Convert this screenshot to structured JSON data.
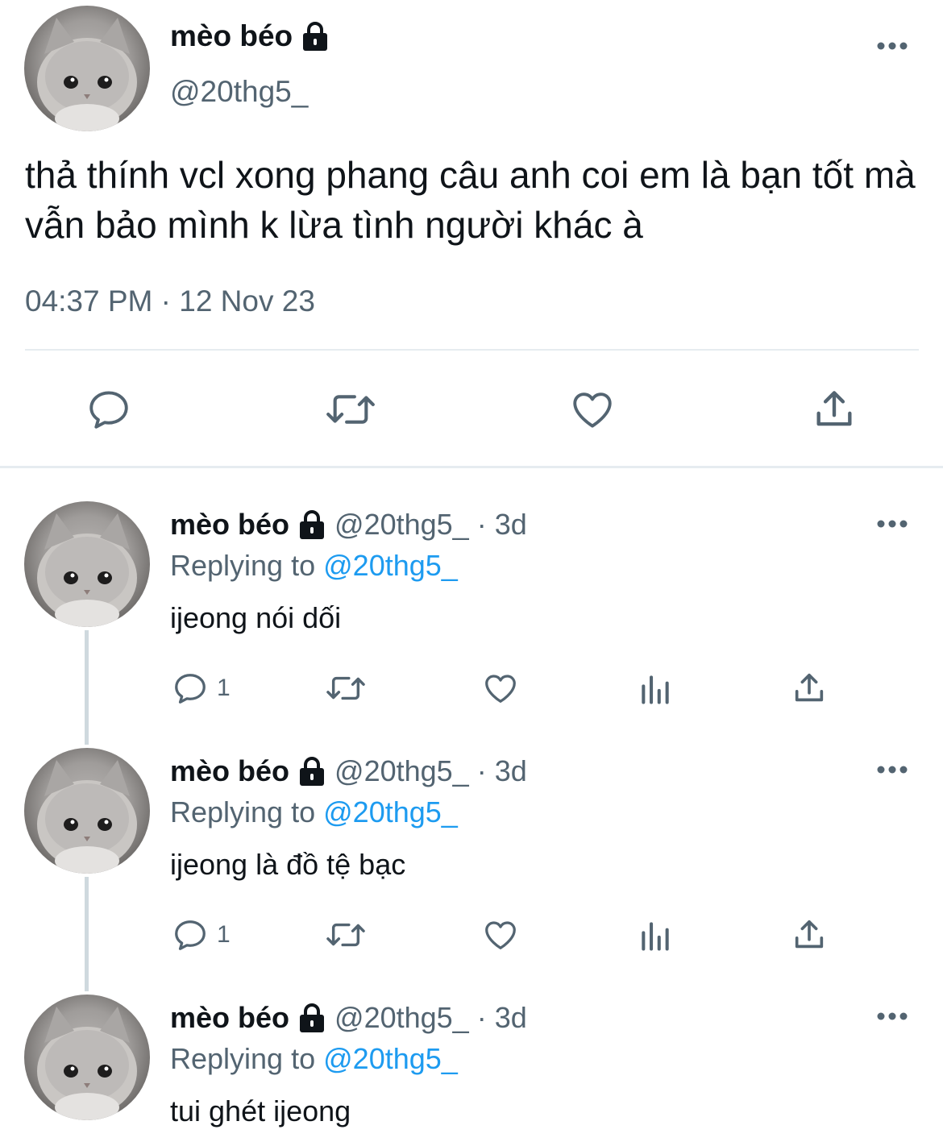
{
  "main_tweet": {
    "display_name": "mèo béo",
    "handle": "@20thg5_",
    "text": "thả thính vcl xong phang câu anh coi em là bạn tốt mà vẫn bảo mình k lừa tình người khác à",
    "timestamp": "04:37 PM · 12 Nov 23",
    "icons": [
      "reply-icon",
      "retweet-icon",
      "like-icon",
      "share-icon"
    ]
  },
  "replies": [
    {
      "display_name": "mèo béo",
      "meta": "@20thg5_ · 3d",
      "replying_label": "Replying to",
      "replying_to": "@20thg5_",
      "text": "ijeong nói dối",
      "reply_count": "1"
    },
    {
      "display_name": "mèo béo",
      "meta": "@20thg5_ · 3d",
      "replying_label": "Replying to",
      "replying_to": "@20thg5_",
      "text": "ijeong là đồ tệ bạc",
      "reply_count": "1"
    },
    {
      "display_name": "mèo béo",
      "meta": "@20thg5_ · 3d",
      "replying_label": "Replying to",
      "replying_to": "@20thg5_",
      "text": "tui ghét ijeong"
    }
  ],
  "colors": {
    "text": "#0f1419",
    "secondary": "#536471",
    "link": "#1d9bf0",
    "divider": "#e6ecf0"
  }
}
